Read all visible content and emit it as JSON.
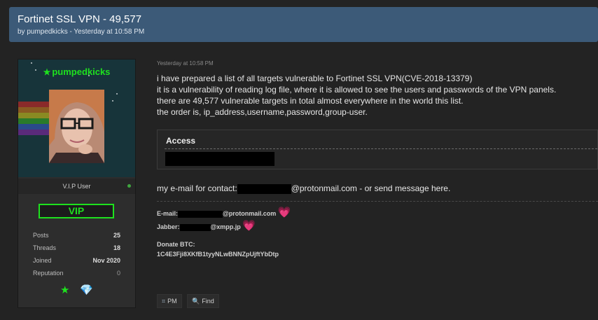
{
  "thread": {
    "title": "Fortinet SSL VPN - 49,577",
    "subtitle": "by pumpedkicks - Yesterday at 10:58 PM"
  },
  "user": {
    "name": "pumpedkicks",
    "title": "V.I.P User",
    "badge": "VIP",
    "stats": [
      {
        "label": "Posts",
        "value": "25"
      },
      {
        "label": "Threads",
        "value": "18"
      },
      {
        "label": "Joined",
        "value": "Nov 2020"
      },
      {
        "label": "Reputation",
        "value": "0"
      }
    ]
  },
  "post": {
    "time": "Yesterday at 10:58 PM",
    "lines": [
      "i have prepared a list of all targets vulnerable to Fortinet SSL VPN(CVE-2018-13379)",
      "it is a vulnerability of reading log file, where it is allowed to see the users and passwords of the VPN panels.",
      "there are 49,577 vulnerable targets in total almost everywhere in the world this list.",
      "the order is, ip_address,username,password,group-user."
    ],
    "code_title": "Access",
    "contact_prefix": "my e-mail for contact:",
    "contact_suffix": "@protonmail.com - or send message here."
  },
  "signature": {
    "email_label": "E-mail:",
    "email_domain": "@protonmail.com",
    "jabber_label": "Jabber:",
    "jabber_domain": "@xmpp.jp",
    "btc_label": "Donate BTC:",
    "btc_address": "1C4E3Fji8XKfB1tyyNLwBNNZpUjftYbDtp"
  },
  "buttons": {
    "pm": "PM",
    "find": "Find"
  },
  "colors": {
    "header": "#3c5a78",
    "accent_green": "#1ee11e",
    "heart": "#e040a0"
  }
}
